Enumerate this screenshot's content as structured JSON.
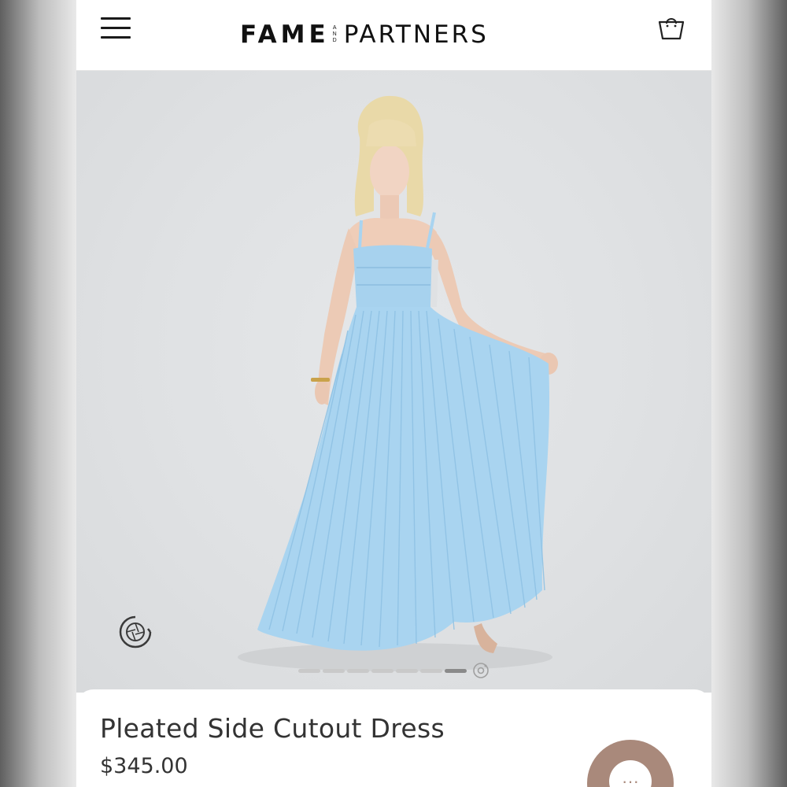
{
  "header": {
    "menu_icon": "hamburger-menu-icon",
    "brand_left": "FAME",
    "brand_and_top": "A",
    "brand_and_mid": "N",
    "brand_and_bottom": "D",
    "brand_right": "PARTNERS",
    "cart_icon": "shopping-bag-icon"
  },
  "gallery": {
    "image_subject": "model-in-light-blue-pleated-gown",
    "camera_icon": "camera-aperture-icon",
    "slide_count": 7,
    "active_slide": 7,
    "view360_icon": "360-view-icon"
  },
  "product": {
    "title": "Pleated Side Cutout Dress",
    "price": "$345.00"
  },
  "chat": {
    "icon": "chat-bubble-icon",
    "glyph": "···"
  },
  "colors": {
    "dress": "#a9d4f0",
    "accent_chat": "#a9897b",
    "text": "#333333"
  }
}
